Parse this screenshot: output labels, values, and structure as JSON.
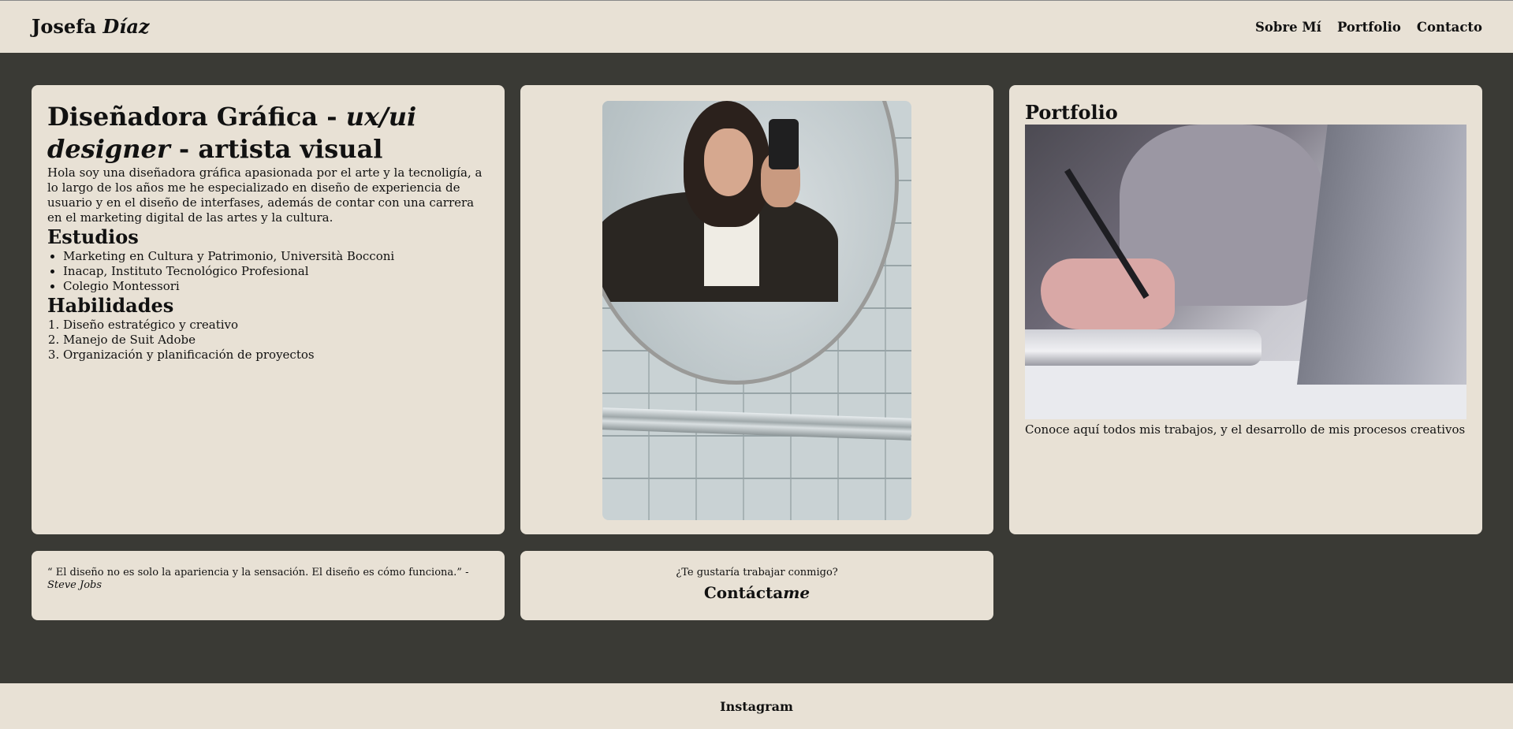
{
  "header": {
    "brand_first": "Josefa",
    "brand_last": "Díaz",
    "nav": [
      {
        "label": "Sobre Mí"
      },
      {
        "label": "Portfolio"
      },
      {
        "label": "Contacto"
      }
    ]
  },
  "about": {
    "title_part1": "Diseñadora Gráfica - ",
    "title_italic": "ux/ui designer",
    "title_part2": " - artista visual",
    "intro": "Hola soy una diseñadora gráfica apasionada por el arte y la tecnoligía, a lo largo de los años me he especializado en diseño de experiencia de usuario y en el diseño de interfases, además de contar con una carrera en el marketing digital de las artes y la cultura.",
    "studies_heading": "Estudios",
    "studies": [
      "Marketing en Cultura y Patrimonio, Università Bocconi",
      "Inacap, Instituto Tecnológico Profesional",
      "Colegio Montessori"
    ],
    "skills_heading": "Habilidades",
    "skills": [
      "Diseño estratégico y creativo",
      "Manejo de Suit Adobe",
      "Organización y planificación de proyectos"
    ]
  },
  "portfolio": {
    "heading": "Portfolio",
    "description": "Conoce aquí todos mis trabajos, y el desarrollo de mis procesos creativos"
  },
  "quote": {
    "text": "“ El diseño no es solo la apariencia y la sensación. El diseño es cómo funciona.” - ",
    "author": "Steve Jobs"
  },
  "contact": {
    "question": "¿Te gustaría trabajar conmigo?",
    "cta_part1": "Contácta",
    "cta_italic": "me"
  },
  "footer": {
    "link": "Instagram"
  }
}
